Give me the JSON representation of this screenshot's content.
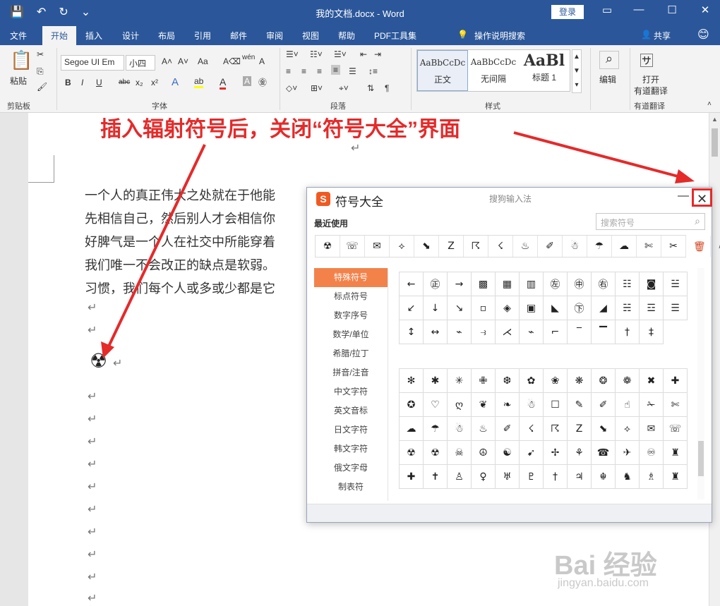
{
  "titlebar": {
    "title": "我的文档.docx  -  Word",
    "login_label": "登录",
    "qat_icons": [
      "save-icon",
      "undo-icon",
      "redo-icon",
      "customize-icon"
    ]
  },
  "tabs": [
    "文件",
    "开始",
    "插入",
    "设计",
    "布局",
    "引用",
    "邮件",
    "审阅",
    "视图",
    "帮助",
    "PDF工具集"
  ],
  "active_tab": "开始",
  "tell_me": "操作说明搜索",
  "share": "共享",
  "ribbon": {
    "clipboard": {
      "label": "剪贴板",
      "paste": "粘贴"
    },
    "font": {
      "label": "字体",
      "name": "Segoe UI Em",
      "size": "小四",
      "buttons": [
        "B",
        "I",
        "U",
        "abc",
        "x₂",
        "x²"
      ]
    },
    "paragraph": {
      "label": "段落"
    },
    "styles": {
      "label": "样式",
      "items": [
        {
          "preview": "AaBbCcDc",
          "name": "正文"
        },
        {
          "preview": "AaBbCcDc",
          "name": "无间隔"
        },
        {
          "preview": "AaBl",
          "name": "标题 1"
        }
      ]
    },
    "edit": {
      "label": "编辑"
    },
    "translate": {
      "label": "有道翻译",
      "button": "打开\n有道翻译",
      "line1": "打开",
      "line2": "有道翻译"
    }
  },
  "annotation": "插入辐射符号后，关闭“符号大全”界面",
  "document": {
    "lines": [
      "一个人的真正伟大之处就在于他能",
      "先相信自己，然后别人才会相信你",
      "好脾气是一个人在社交中所能穿着",
      "我们唯一不会改正的缺点是软弱。",
      "习惯，我们每个人或多或少都是它"
    ],
    "inserted_symbol": "☢",
    "paragraph_mark": "↵"
  },
  "symbol_panel": {
    "title": "符号大全",
    "subtitle": "搜狗输入法",
    "recent_label": "最近使用",
    "search_placeholder": "搜索符号",
    "recent": [
      "☢",
      "☏",
      "✉",
      "⟡",
      "⬊",
      "Z",
      "☈",
      "☇",
      "♨",
      "✐",
      "☃",
      "☂",
      "☁",
      "✄",
      "✂",
      "☝",
      "✍"
    ],
    "categories": [
      "特殊符号",
      "标点符号",
      "数字序号",
      "数学/单位",
      "希腊/拉丁",
      "拼音/注音",
      "中文字符",
      "英文音标",
      "日文字符",
      "韩文字符",
      "俄文字母",
      "制表符"
    ],
    "active_category": "特殊符号",
    "grid1": [
      [
        "←",
        "㊣",
        "→",
        "▩",
        "▦",
        "▥",
        "㊧",
        "㊥",
        "㊨",
        "☷",
        "◙",
        "☱"
      ],
      [
        "↙",
        "↓",
        "↘",
        "▫",
        "◈",
        "▣",
        "◣",
        "㊦",
        "◢",
        "☵",
        "☲",
        "☰"
      ],
      [
        "↕",
        "↔",
        "⌁",
        "⥽",
        "⋌",
        "⌁",
        "⌐",
        "‾",
        "▔",
        "†",
        "‡"
      ]
    ],
    "grid2": [
      [
        "✻",
        "✱",
        "✳",
        "✙",
        "❆",
        "✿",
        "❀",
        "❋",
        "❂",
        "❁",
        "✖",
        "✚"
      ],
      [
        "✪",
        "♡",
        "ღ",
        "❦",
        "❧",
        "☃",
        "☐",
        "✎",
        "✐",
        "☝",
        "✁",
        "✄"
      ],
      [
        "☁",
        "☂",
        "☃",
        "♨",
        "✐",
        "☇",
        "☈",
        "Z",
        "⬊",
        "⟡",
        "✉",
        "☏"
      ],
      [
        "☢",
        "☢",
        "☠",
        "☮",
        "☯",
        "➹",
        "✢",
        "⚘",
        "☎",
        "✈",
        "♾",
        "♜"
      ],
      [
        "✚",
        "✝",
        "♙",
        "♀",
        "♅",
        "♇",
        "†",
        "♃",
        "☬",
        "♞",
        "♗",
        "♜"
      ]
    ]
  },
  "watermark": {
    "text": "Bai 经验",
    "url": "jingyan.baidu.com"
  },
  "colors": {
    "word_blue": "#2b579a",
    "annotation_red": "#e52a2a",
    "category_orange": "#f2824a"
  }
}
